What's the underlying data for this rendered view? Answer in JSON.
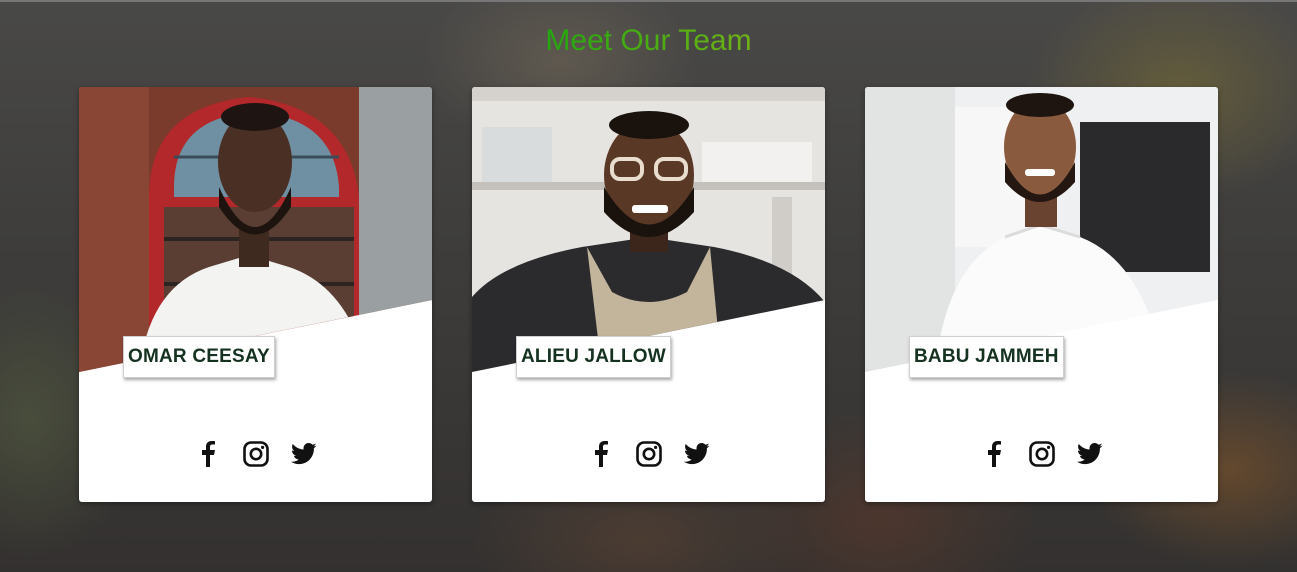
{
  "section": {
    "title": "Meet Our Team"
  },
  "team": [
    {
      "name": "OMAR CEESAY",
      "photo_alt": "Chef portrait in white jacket, red brick kitchen background"
    },
    {
      "name": "ALIEU JALLOW",
      "photo_alt": "Chef portrait wearing glasses, dark jacket and apron, white shelves"
    },
    {
      "name": "BABU JAMMEH",
      "photo_alt": "Chef portrait in white jacket, bright kitchen background"
    }
  ],
  "social_icons": [
    "facebook-icon",
    "instagram-icon",
    "twitter-icon"
  ],
  "colors": {
    "title_green": "#19a60e",
    "title_lime": "#7ab317",
    "name_text": "#153220",
    "card_bg": "#ffffff"
  }
}
